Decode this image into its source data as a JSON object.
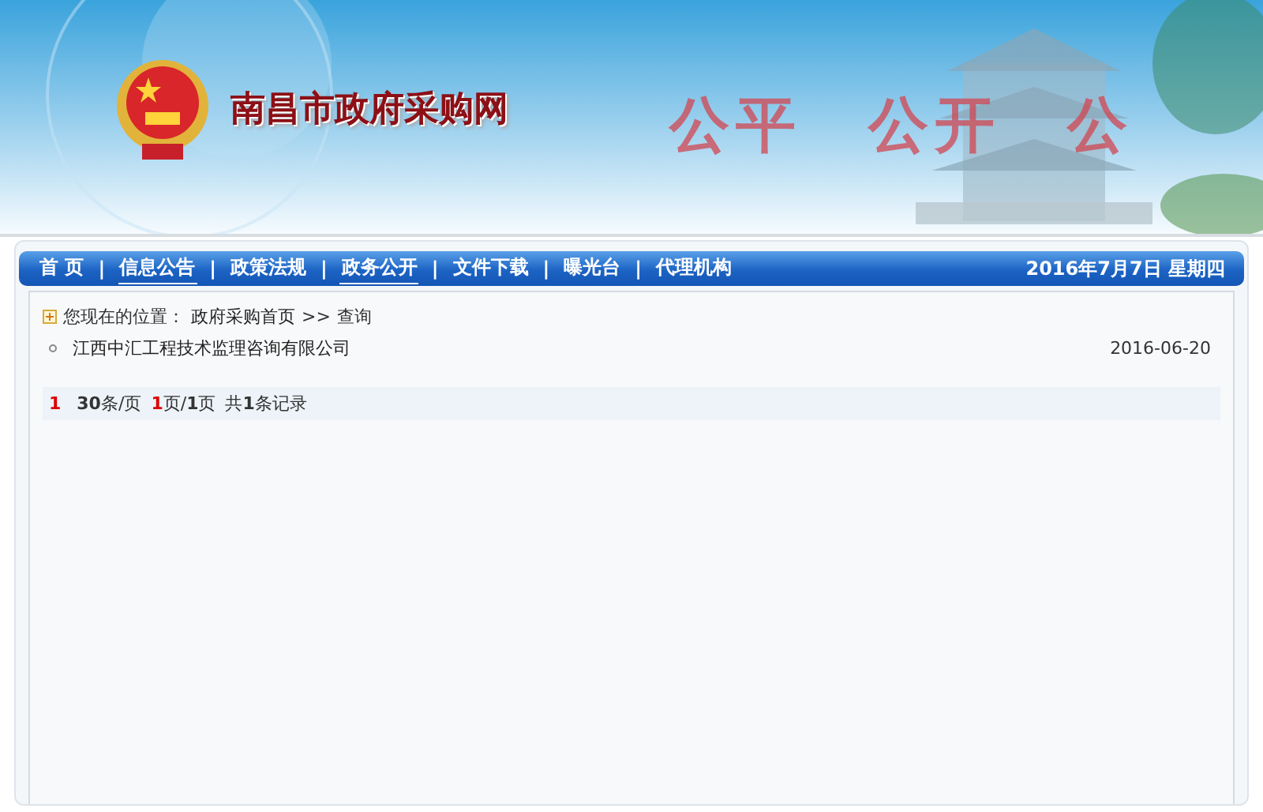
{
  "header": {
    "site_title": "南昌市政府采购网",
    "slogans": [
      "公平",
      "公开",
      "公"
    ]
  },
  "nav": {
    "items": [
      {
        "label": "首 页",
        "underlined": false
      },
      {
        "label": "信息公告",
        "underlined": true
      },
      {
        "label": "政策法规",
        "underlined": false
      },
      {
        "label": "政务公开",
        "underlined": true
      },
      {
        "label": "文件下载",
        "underlined": false
      },
      {
        "label": "曝光台",
        "underlined": false
      },
      {
        "label": "代理机构",
        "underlined": false
      }
    ],
    "separator": "|",
    "date": "2016年7月7日  星期四"
  },
  "breadcrumb": {
    "prefix": "您现在的位置：",
    "home": "政府采购首页",
    "separator": ">>",
    "current": "查询"
  },
  "results": [
    {
      "title": "江西中汇工程技术监理咨询有限公司",
      "date": "2016-06-20"
    }
  ],
  "pager": {
    "page_link": "1",
    "per_page": "**30**条/页",
    "current_page": "1",
    "page_rest": "页/**1**页",
    "total": "共**1**条记录"
  }
}
